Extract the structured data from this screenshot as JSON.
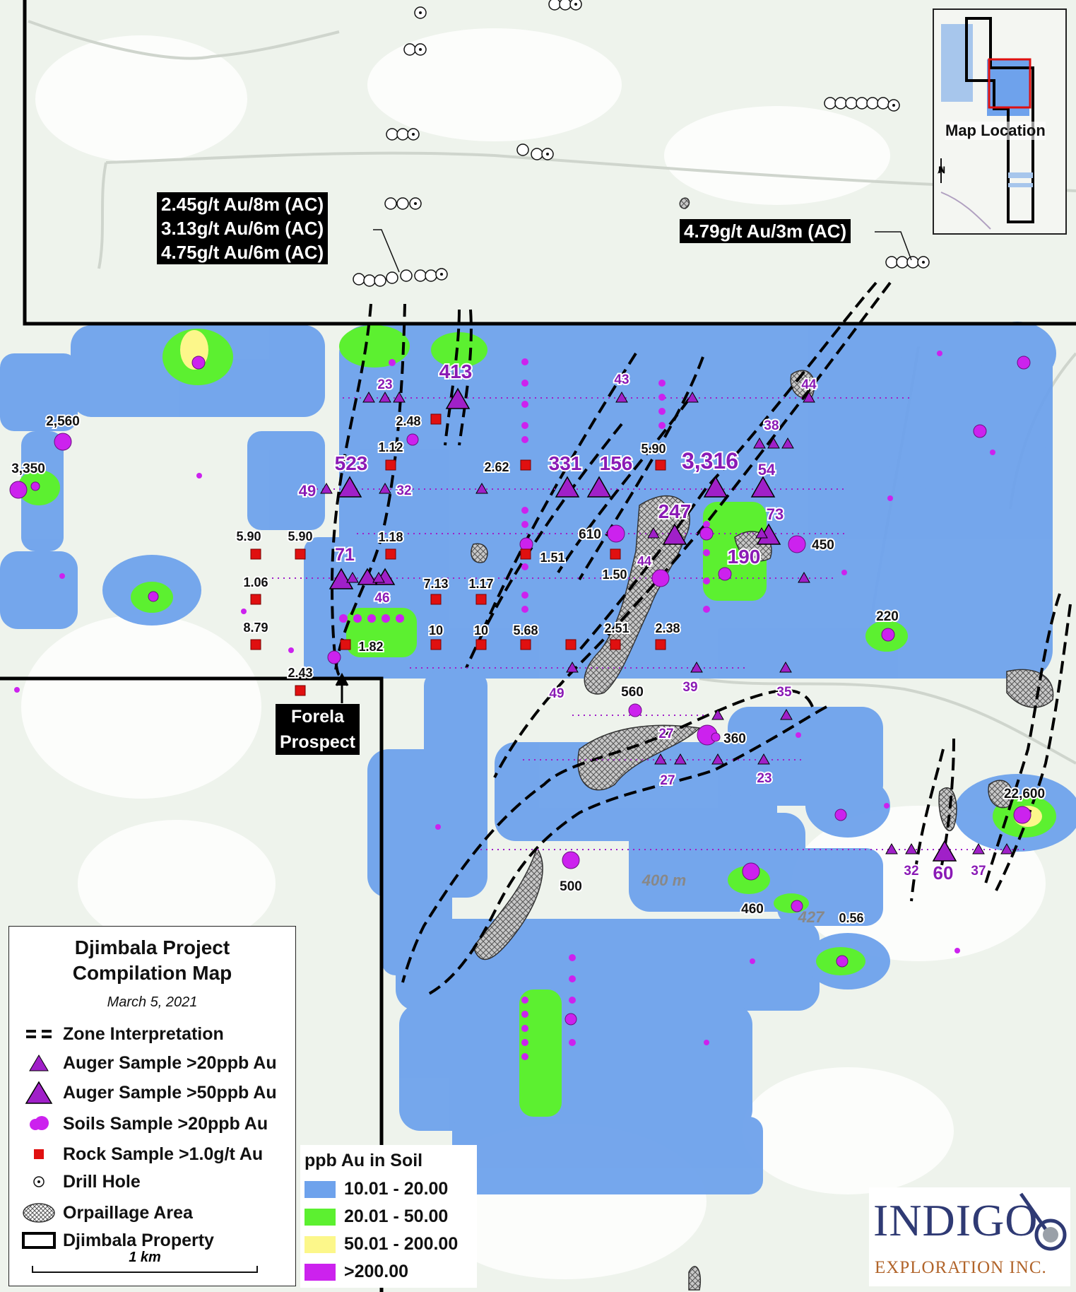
{
  "callouts": {
    "left": [
      "2.45g/t Au/8m (AC)",
      "3.13g/t Au/6m (AC)",
      "4.75g/t Au/6m (AC)"
    ],
    "right": "4.79g/t Au/3m (AC)",
    "forela": [
      "Forela",
      "Prospect"
    ]
  },
  "auger_labels": [
    "23",
    "413",
    "43",
    "44",
    "38",
    "523",
    "49",
    "32",
    "331",
    "156",
    "3,316",
    "54",
    "247",
    "73",
    "71",
    "46",
    "190",
    "44",
    "49",
    "39",
    "35",
    "27",
    "27",
    "23",
    "32",
    "60",
    "37"
  ],
  "soil_labels": [
    "2,560",
    "3,350",
    "610",
    "450",
    "220",
    "560",
    "360",
    "500",
    "460",
    "22,600"
  ],
  "rock_labels": [
    "2.48",
    "1.12",
    "2.62",
    "5.90",
    "5.90",
    "5.90",
    "1.18",
    "1.51",
    "1.06",
    "7.13",
    "1.17",
    "1.50",
    "8.79",
    "10",
    "10",
    "5.68",
    "2.51",
    "2.38",
    "1.82",
    "2.43",
    "0.56"
  ],
  "topo_labels": [
    "400 m",
    "427"
  ],
  "inset": {
    "label": "Map Location",
    "north": "N"
  },
  "legend": {
    "title_line1": "Djimbala Project",
    "title_line2": "Compilation Map",
    "date": "March 5, 2021",
    "items": [
      "Zone Interpretation",
      "Auger Sample >20ppb Au",
      "Auger Sample >50ppb Au",
      "Soils Sample >20ppb Au",
      "Rock Sample >1.0g/t Au",
      "Drill Hole",
      "Orpaillage Area",
      "Djimbala Property"
    ],
    "scale": "1 km"
  },
  "soil_legend": {
    "title": "ppb Au in Soil",
    "classes": [
      {
        "label": "10.01 - 20.00",
        "color": "#6ea2ec"
      },
      {
        "label": "20.01 - 50.00",
        "color": "#5cf030"
      },
      {
        "label": "50.01 - 200.00",
        "color": "#fcf78a"
      },
      {
        "label": ">200.00",
        "color": "#cc22ee"
      }
    ]
  },
  "logo": {
    "main": "INDIGO",
    "sub": "EXPLORATION INC."
  },
  "colors": {
    "auger": "#a020c8",
    "soil": "#cc22ee",
    "rock": "#e01010",
    "property": "#000000",
    "orpaillage": "#8a8a8a"
  }
}
